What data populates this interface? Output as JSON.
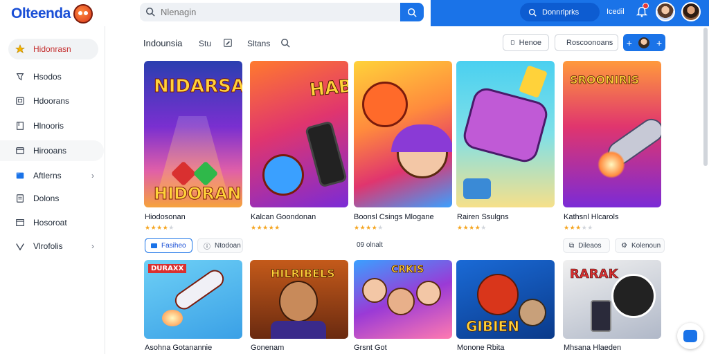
{
  "app": {
    "logo_text": "Olteenda"
  },
  "search": {
    "placeholder": "Nlenagin"
  },
  "header": {
    "pill_label": "Donnrlprks",
    "user_label": "Icedil"
  },
  "sidebar": {
    "items": [
      {
        "label": "Hidonrasn",
        "icon": "star-icon",
        "active": true
      },
      {
        "label": "Hsodos",
        "icon": "pin-icon"
      },
      {
        "label": "Hdoorans",
        "icon": "window-icon"
      },
      {
        "label": "Hlnooris",
        "icon": "bookmark-icon"
      },
      {
        "label": "Hirooans",
        "icon": "card-icon",
        "hover": true
      },
      {
        "label": "Aftlerns",
        "icon": "folder-icon",
        "chevron": true
      },
      {
        "label": "Dolons",
        "icon": "document-icon"
      },
      {
        "label": "Hosoroat",
        "icon": "mail-icon"
      },
      {
        "label": "Vlrofolis",
        "icon": "check-icon",
        "chevron": true
      }
    ]
  },
  "toolbar": {
    "title": "Indounsia",
    "link1": "Stu",
    "link2": "Sltans",
    "btn_home": "Henoe",
    "btn_recommend": "Roscoonoans"
  },
  "cards_row1": [
    {
      "title": "Hiodosonan",
      "rating": 4,
      "art_text": "HIDORAN",
      "art_top": "NIDARSAIS"
    },
    {
      "title": "Kalcan Goondonan",
      "rating": 5,
      "art_text": "HABAN!"
    },
    {
      "title": "Boonsl Csings Mlogane",
      "rating": 4
    },
    {
      "title": "Rairen Ssulgns",
      "rating": 4
    },
    {
      "title": "Kathsnl Hlcarols",
      "rating": 3,
      "art_text": "SROONIRIS"
    }
  ],
  "card_actions": {
    "c1_primary": "Fasiheo",
    "c1_secondary": "Ntodoan",
    "c3_meta": "09 olnalt",
    "c5_a": "Dileaos",
    "c5_b": "Kolenoun"
  },
  "cards_row2": [
    {
      "title": "Asohna Gotanannie",
      "art_text": "DURAXX"
    },
    {
      "title": "Gonenam",
      "art_text": "HILRIBELS"
    },
    {
      "title": "Grsnt Got",
      "art_text": "CRKIS"
    },
    {
      "title": "Monone Rbita",
      "art_text": "GIBIEN"
    },
    {
      "title": "Mhsana Hlaeden",
      "art_text": "RARAK"
    }
  ]
}
